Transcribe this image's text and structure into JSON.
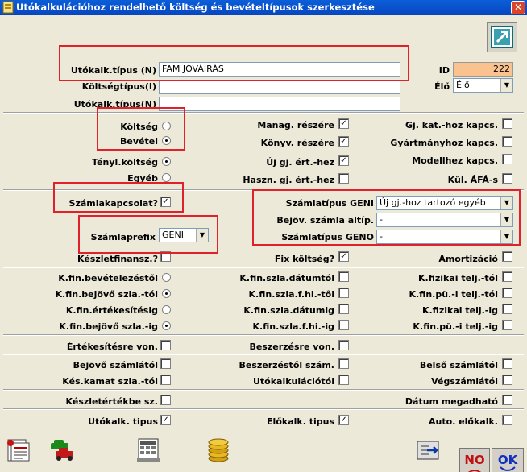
{
  "window": {
    "title": "Utókalkulációhoz rendelhető költség és bevételtípusok szerkesztése",
    "close_glyph": "✕"
  },
  "header": {
    "utokalk_tipus_label": "Utókalk.típus (N)",
    "utokalk_tipus_value": "FAM JÓVÁÍRÁS",
    "koltsegtipus_label": "Költségtípus(I)",
    "utokalk_tipus2_label": "Utókalk.típus(N)",
    "id_label": "ID",
    "id_value": "222",
    "elo_label": "Élő",
    "elo_value": "Élő"
  },
  "section1": {
    "koltseg_label": "Költség",
    "bevetel_label": "Bevétel",
    "tenyl_koltseg_label": "Tényl.költség",
    "egyeb_label": "Egyéb",
    "manag_label": "Manag. részére",
    "konyv_label": "Könyv. részére",
    "uj_gj_label": "Új gj. ért.-hez",
    "haszn_gj_label": "Haszn. gj. ért.-hez",
    "gj_kat_label": "Gj. kat.-hoz kapcs.",
    "gyartmany_label": "Gyártmányhoz kapcs.",
    "modell_label": "Modellhez kapcs.",
    "kul_afa_label": "Kül. ÁFÁ-s"
  },
  "section2": {
    "szamlakapcsolat_label": "Számlakapcsolat?",
    "szamlaprefix_label": "Számlaprefix",
    "szamlaprefix_value": "GENI",
    "szamlatipus_geni_label": "Számlatípus GENI",
    "szamlatipus_geni_value": "Új gj.-hoz tartozó egyéb",
    "bejov_altip_label": "Bejöv. számla altíp.",
    "bejov_altip_value": "-",
    "szamlatipus_geno_label": "Számlatípus GENO",
    "szamlatipus_geno_value": "-"
  },
  "section3": {
    "keszletfinansz_label": "Készletfinansz.?",
    "fix_koltseg_label": "Fix költség?",
    "amortizacio_label": "Amortizáció",
    "kfin_bevetelezestol_label": "K.fin.bevételezéstől",
    "kfin_bejovo_tol_label": "K.fin.bejövő szla.-tól",
    "kfin_ertekesitesig_label": "K.fin.értékesítésig",
    "kfin_bejovo_ig_label": "K.fin.bejövő szla.-ig",
    "kfin_szla_datumtol_label": "K.fin.szla.dátumtól",
    "kfin_szla_fhi_tol_label": "K.fin.szla.f.hi.-től",
    "kfin_szla_datumig_label": "K.fin.szla.dátumig",
    "kfin_szla_fhi_ig_label": "K.fin.szla.f.hi.-ig",
    "kfizikai_tol_label": "K.fizikai telj.-tól",
    "kfin_pu_tol_label": "K.fin.pü.-i telj.-tól",
    "kfizikai_ig_label": "K.fizikai telj.-ig",
    "kfin_pu_ig_label": "K.fin.pü.-i telj.-ig"
  },
  "section4": {
    "ertekesitesre_label": "Értékesítésre von.",
    "beszerzesre_label": "Beszerzésre von."
  },
  "section5": {
    "bejovo_szamlatol_label": "Bejövő számlától",
    "kes_kamat_label": "Kés.kamat szla.-tól",
    "beszerzestol_label": "Beszerzéstől szám.",
    "utokalkulaciotol_label": "Utókalkulációtól",
    "belso_szamlatol_label": "Belső számlától",
    "vegszamlatol_label": "Végszámlától"
  },
  "section6": {
    "keszletertekbe_label": "Készletértékbe sz.",
    "datum_megadhato_label": "Dátum megadható"
  },
  "section7": {
    "utokalk_tipus_label": "Utókalk. tipus",
    "elokalk_tipus_label": "Előkalk. tipus",
    "auto_elokalk_label": "Auto. előkalk."
  },
  "footer": {
    "no_label": "NO",
    "ok_label": "OK"
  },
  "check_glyph": "✓",
  "colors": {
    "titlebar": "#0a5fd8",
    "window_bg": "#ece9d8",
    "highlight": "#e0202a",
    "id_bg": "#f9c28f"
  }
}
